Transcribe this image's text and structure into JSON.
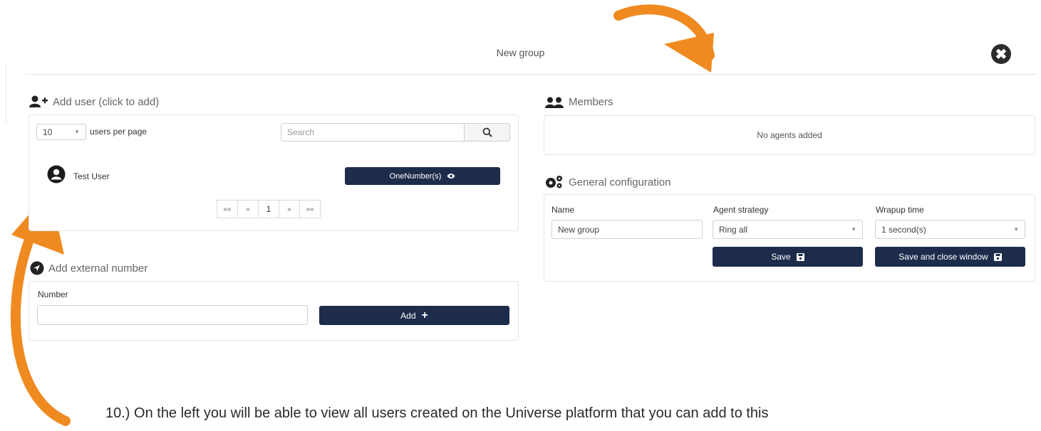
{
  "dialog": {
    "title": "New group",
    "close_icon": "✖"
  },
  "add_user": {
    "heading": "Add user (click to add)",
    "per_page_value": "10",
    "per_page_label": "users per page",
    "search_placeholder": "Search",
    "users": [
      {
        "name": "Test User",
        "button_label": "OneNumber(s)"
      }
    ],
    "pagination": {
      "first": "««",
      "prev": "«",
      "current": "1",
      "next": "»",
      "last": "»»"
    }
  },
  "external": {
    "heading": "Add external number",
    "number_label": "Number",
    "number_value": "",
    "add_label": "Add"
  },
  "members": {
    "heading": "Members",
    "empty_text": "No agents added"
  },
  "config": {
    "heading": "General configuration",
    "name_label": "Name",
    "name_value": "New group",
    "strategy_label": "Agent strategy",
    "strategy_value": "Ring all",
    "wrapup_label": "Wrapup time",
    "wrapup_value": "1 second(s)",
    "save_label": "Save",
    "save_close_label": "Save and close window"
  },
  "caption": "10.) On the left you will be able to view all users created on the Universe platform that you can add to this",
  "colors": {
    "navy": "#1e2c4c",
    "arrow": "#ef8a21"
  }
}
